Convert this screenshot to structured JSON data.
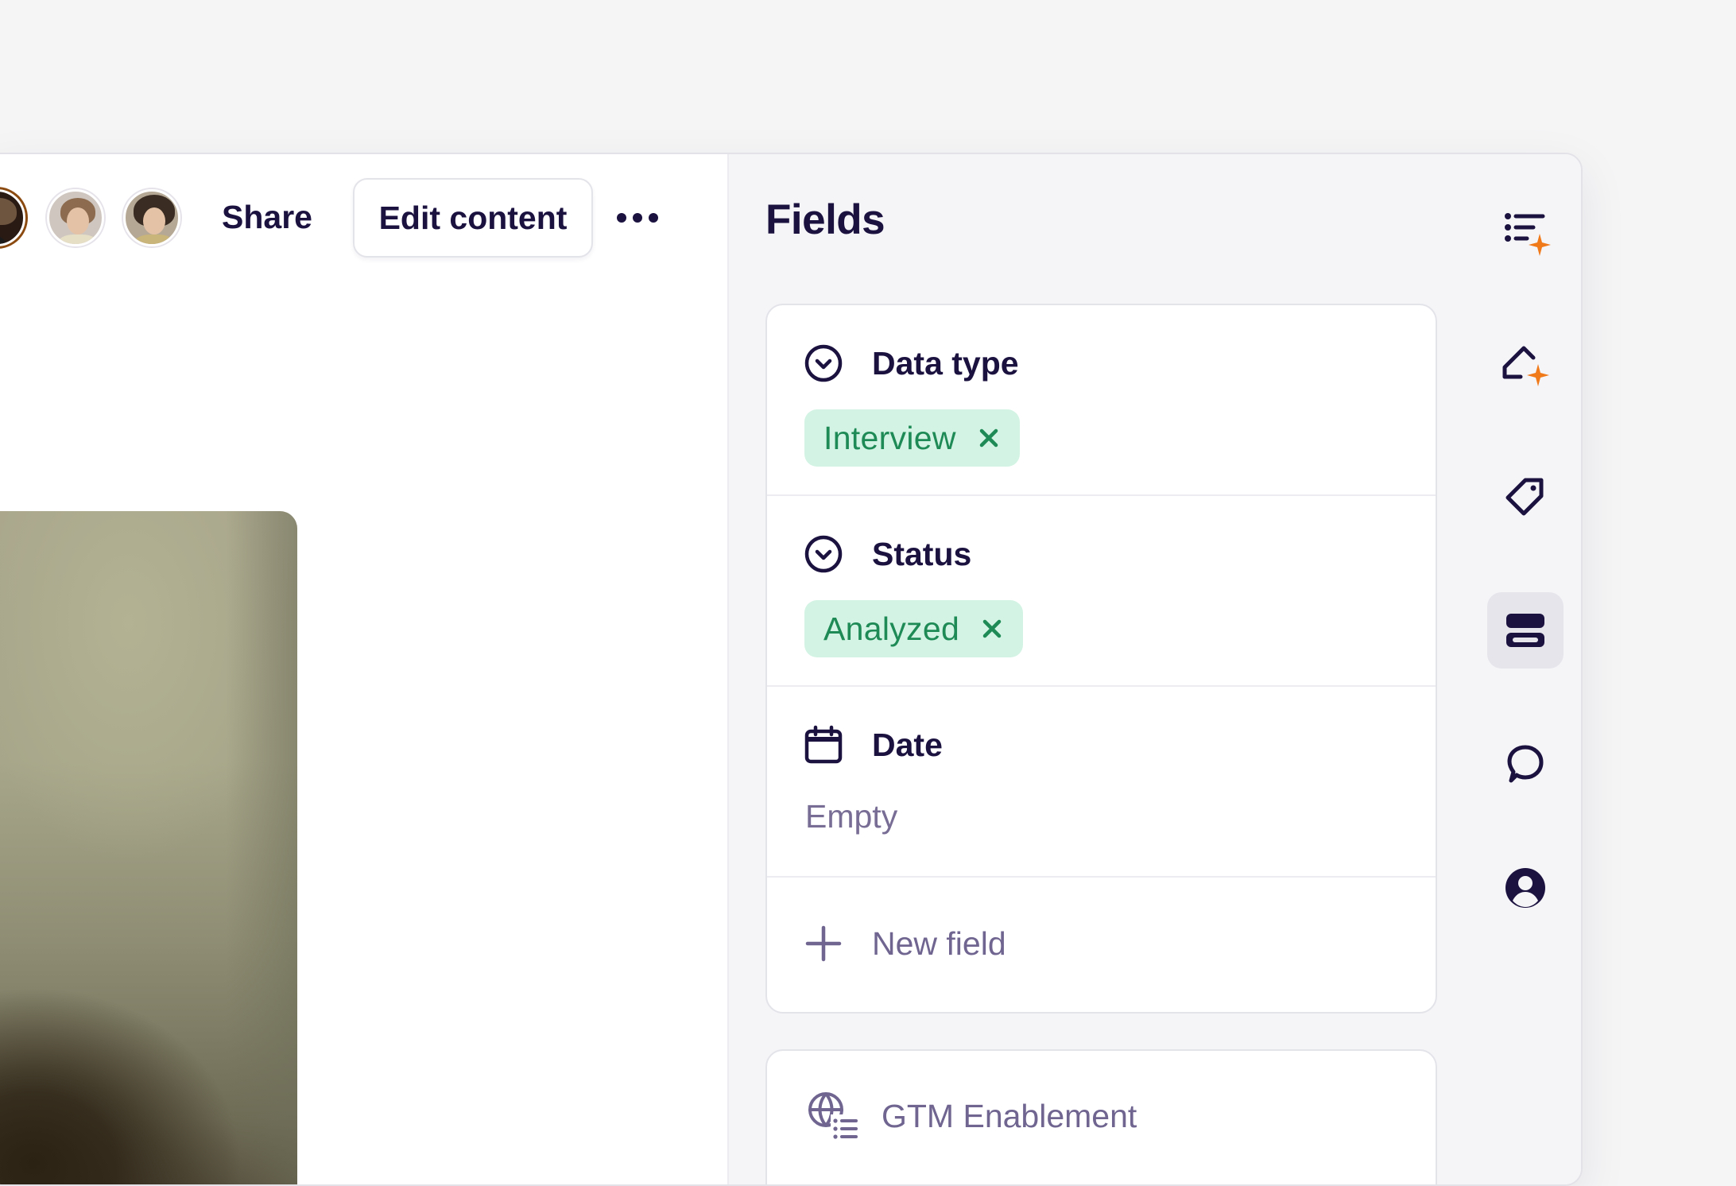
{
  "toolbar": {
    "share_label": "Share",
    "edit_label": "Edit content",
    "more_icon": "more-horizontal-icon"
  },
  "collaborators": [
    {
      "name": "avatar-1"
    },
    {
      "name": "avatar-2"
    },
    {
      "name": "avatar-3"
    }
  ],
  "fields_panel": {
    "title": "Fields",
    "fields": [
      {
        "label": "Data type",
        "icon": "select-icon",
        "value": "Interview"
      },
      {
        "label": "Status",
        "icon": "select-icon",
        "value": "Analyzed"
      },
      {
        "label": "Date",
        "icon": "calendar-icon",
        "value": "Empty"
      }
    ],
    "new_field_label": "New field",
    "group_label": "GTM Enablement"
  },
  "rail": [
    {
      "icon": "summary-sparkle-icon",
      "active": false
    },
    {
      "icon": "highlight-sparkle-icon",
      "active": false
    },
    {
      "icon": "tag-icon",
      "active": false
    },
    {
      "icon": "fields-icon",
      "active": true
    },
    {
      "icon": "comment-icon",
      "active": false
    },
    {
      "icon": "user-icon",
      "active": false
    }
  ],
  "colors": {
    "ink": "#1c1240",
    "muted": "#6f6590",
    "tag_bg": "#d3f4e4",
    "tag_text": "#1e8a55",
    "accent_sparkle": "#f07a1a"
  }
}
